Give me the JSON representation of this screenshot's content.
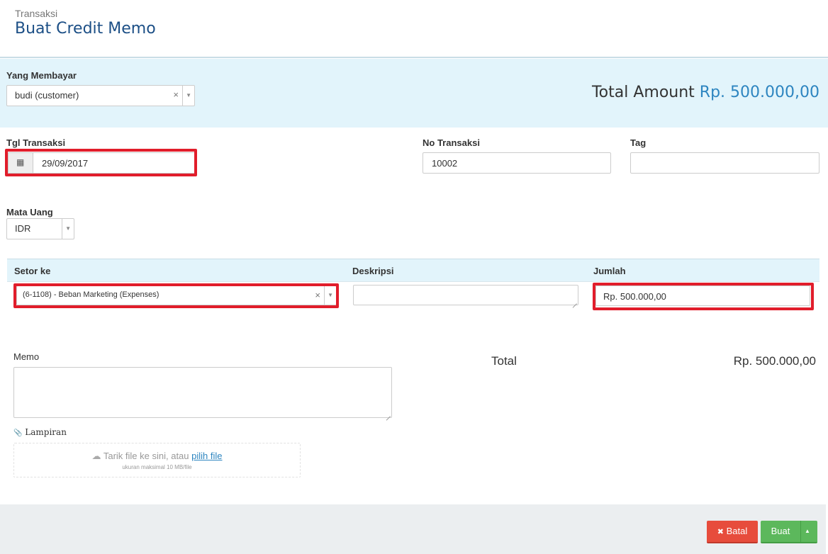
{
  "header": {
    "breadcrumb": "Transaksi",
    "title": "Buat Credit Memo"
  },
  "payer": {
    "label": "Yang Membayar",
    "value": "budi (customer)"
  },
  "total_amount": {
    "label": "Total Amount",
    "value": "Rp. 500.000,00"
  },
  "fields": {
    "date_label": "Tgl Transaksi",
    "date_value": "29/09/2017",
    "number_label": "No Transaksi",
    "number_value": "10002",
    "tag_label": "Tag",
    "tag_value": "",
    "currency_label": "Mata Uang",
    "currency_value": "IDR"
  },
  "lines": {
    "headers": [
      "Setor ke",
      "Deskripsi",
      "Jumlah"
    ],
    "rows": [
      {
        "account": "(6-1108) - Beban Marketing (Expenses)",
        "description": "",
        "amount": "Rp. 500.000,00"
      }
    ]
  },
  "memo": {
    "label": "Memo",
    "value": ""
  },
  "summary": {
    "total_label": "Total",
    "total_value": "Rp. 500.000,00"
  },
  "attachment": {
    "label": "Lampiran",
    "drop_text": "Tarik file ke sini, atau",
    "pick_link": "pilih file",
    "hint": "ukuran maksimal 10 MB/file"
  },
  "buttons": {
    "cancel": "Batal",
    "create": "Buat"
  },
  "icons": {
    "clear": "×",
    "dropdown": "▼",
    "calendar": "▦",
    "paperclip": "📎",
    "cloud": "☁",
    "cancel_x": "✖",
    "caret_up": "▲"
  },
  "colors": {
    "accent": "#2d85c0",
    "title": "#1c4f86",
    "highlight": "#e11d2b",
    "cancel": "#e74c3c",
    "create": "#5cb85c"
  }
}
